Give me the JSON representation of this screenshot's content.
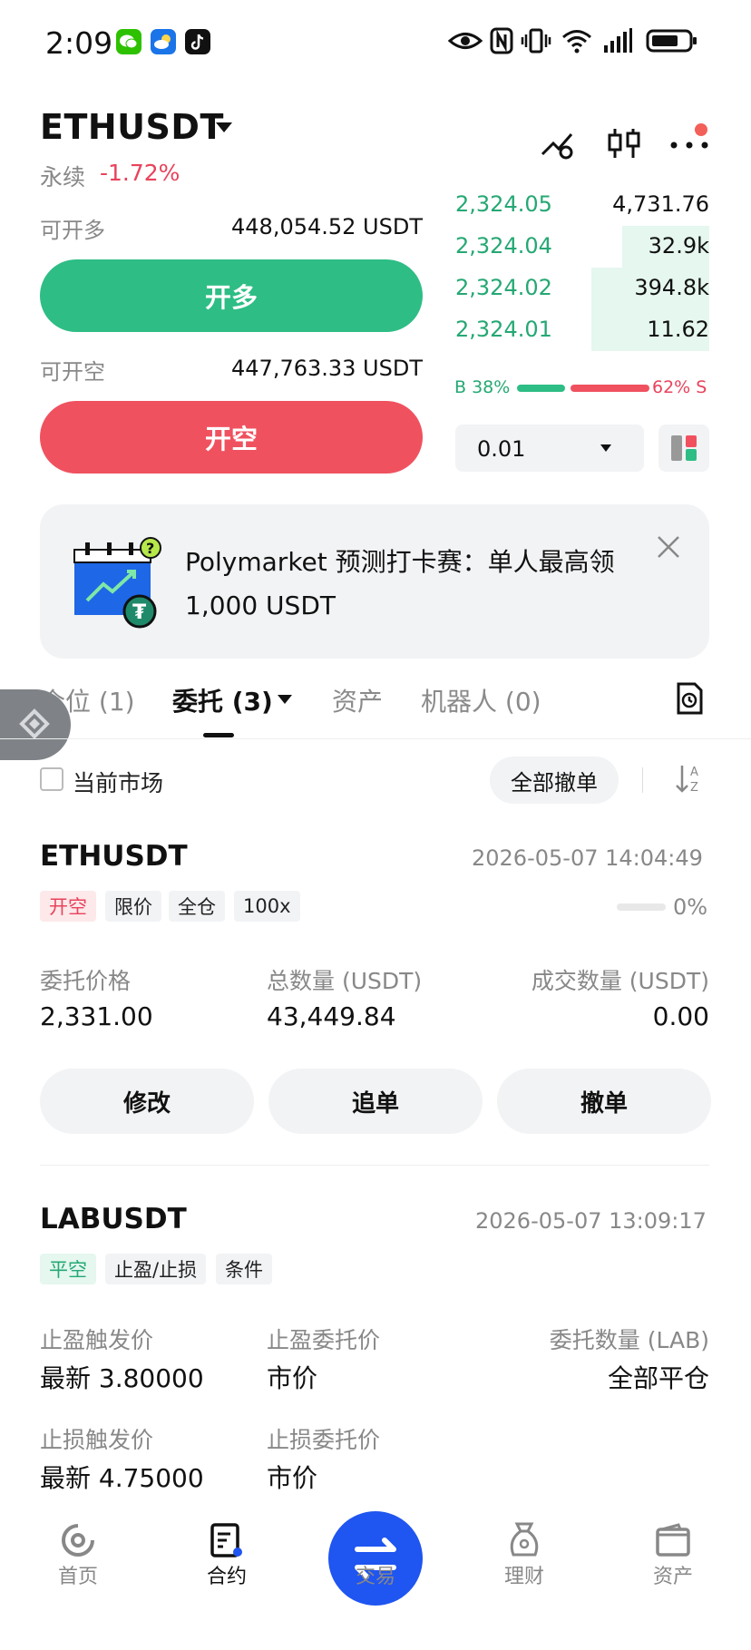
{
  "status_bar": {
    "time": "2:09"
  },
  "header": {
    "pair": "ETHUSDT",
    "market_type": "永续",
    "change": "-1.72%"
  },
  "trade": {
    "long_label": "可开多",
    "long_value": "448,054.52 USDT",
    "long_button": "开多",
    "short_label": "可开空",
    "short_value": "447,763.33 USDT",
    "short_button": "开空"
  },
  "orderbook": {
    "rows": [
      {
        "price": "2,324.05",
        "qty": "4,731.76"
      },
      {
        "price": "2,324.04",
        "qty": "32.9k"
      },
      {
        "price": "2,324.02",
        "qty": "394.8k"
      },
      {
        "price": "2,324.01",
        "qty": "11.62"
      }
    ],
    "buy_ratio": "B 38%",
    "sell_ratio": "62% S",
    "buy_fraction": 0.38,
    "precision": "0.01"
  },
  "promo": {
    "text": "Polymarket 预测打卡赛：单人最高领 1,000 USDT"
  },
  "tabs": [
    {
      "label": "仓位 (1)"
    },
    {
      "label": "委托 (3)"
    },
    {
      "label": "资产"
    },
    {
      "label": "机器人 (0)"
    }
  ],
  "filter": {
    "current_market": "当前市场",
    "cancel_all": "全部撤单"
  },
  "order1": {
    "symbol": "ETHUSDT",
    "time": "2026-05-07 14:04:49",
    "tags": [
      "开空",
      "限价",
      "全仓",
      "100x"
    ],
    "progress": "0%",
    "fields": [
      {
        "label": "委托价格",
        "value": "2,331.00"
      },
      {
        "label": "总数量 (USDT)",
        "value": "43,449.84"
      },
      {
        "label": "成交数量 (USDT)",
        "value": "0.00"
      }
    ],
    "buttons": [
      "修改",
      "追单",
      "撤单"
    ]
  },
  "order2": {
    "symbol": "LABUSDT",
    "time": "2026-05-07 13:09:17",
    "tags": [
      "平空",
      "止盈/止损",
      "条件"
    ],
    "tp_trigger_label": "止盈触发价",
    "tp_trigger_value": "最新 3.80000",
    "tp_order_label": "止盈委托价",
    "tp_order_value": "市价",
    "qty_label": "委托数量 (LAB)",
    "qty_value": "全部平仓",
    "sl_trigger_label": "止损触发价",
    "sl_trigger_value": "最新 4.75000",
    "sl_order_label": "止损委托价",
    "sl_order_value": "市价"
  },
  "bottom_nav": [
    {
      "label": "首页"
    },
    {
      "label": "合约"
    },
    {
      "label": "交易"
    },
    {
      "label": "理财"
    },
    {
      "label": "资产"
    }
  ],
  "colors": {
    "green": "#2ebd85",
    "red": "#f0515f",
    "blue": "#1f55f0"
  }
}
